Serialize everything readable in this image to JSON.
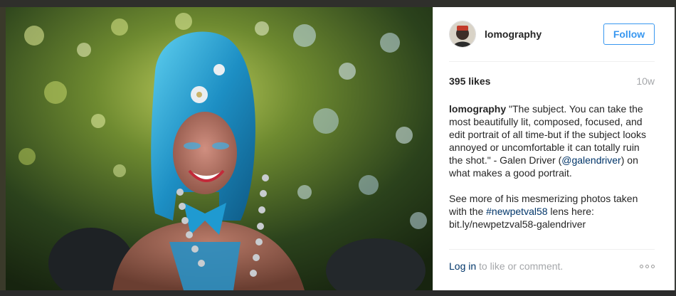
{
  "post": {
    "username": "lomography",
    "follow_label": "Follow",
    "likes": "395 likes",
    "age": "10w",
    "caption": {
      "username": "lomography",
      "text_1": "\"The subject. You can take the most beautifully lit, composed, focused, and edit portrait of all time-but if the subject looks annoyed or uncomfortable it can totally ruin the shot.\" - Galen Driver (",
      "mention": "@galendriver",
      "text_2": ") on what makes a good portrait.",
      "text_3": "See more of his mesmerizing photos taken with the ",
      "hashtag": "#newpetval58",
      "text_4": " lens here:",
      "link_text": "bit.ly/newpetzval58-galendriver"
    },
    "login_label": "Log in",
    "login_suffix": " to like or comment."
  },
  "colors": {
    "accent": "#3897f0",
    "link": "#003569",
    "muted": "#a5a7aa",
    "text": "#262626"
  },
  "icons": {
    "avatar": "lomography-avatar",
    "more": "more-options-icon"
  }
}
